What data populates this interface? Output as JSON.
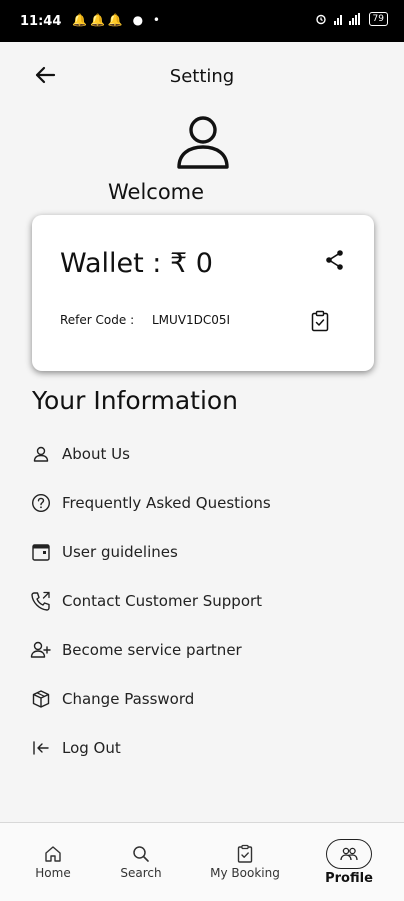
{
  "status_bar": {
    "time": "11:44",
    "notif_icons": [
      "bell-icon",
      "bell-icon",
      "bell-icon",
      "whatsapp-icon",
      "dot-icon"
    ],
    "battery": "79"
  },
  "header": {
    "title": "Setting"
  },
  "profile": {
    "welcome": "Welcome"
  },
  "wallet": {
    "amount_text": "Wallet : ₹ 0",
    "refer_label": "Refer Code :",
    "refer_code": "LMUV1DC05I"
  },
  "section": {
    "title": "Your Information"
  },
  "menu": [
    {
      "label": "About Us",
      "icon": "user-icon"
    },
    {
      "label": "Frequently Asked Questions",
      "icon": "question-icon"
    },
    {
      "label": "User guidelines",
      "icon": "calendar-icon"
    },
    {
      "label": "Contact Customer Support",
      "icon": "phone-icon"
    },
    {
      "label": "Become service partner",
      "icon": "user-plus-icon"
    },
    {
      "label": "Change Password",
      "icon": "box-icon"
    },
    {
      "label": "Log Out",
      "icon": "logout-icon"
    }
  ],
  "nav": [
    {
      "label": "Home",
      "icon": "home-icon"
    },
    {
      "label": "Search",
      "icon": "search-icon"
    },
    {
      "label": "My Booking",
      "icon": "booking-icon"
    },
    {
      "label": "Profile",
      "icon": "users-icon",
      "active": true
    }
  ]
}
